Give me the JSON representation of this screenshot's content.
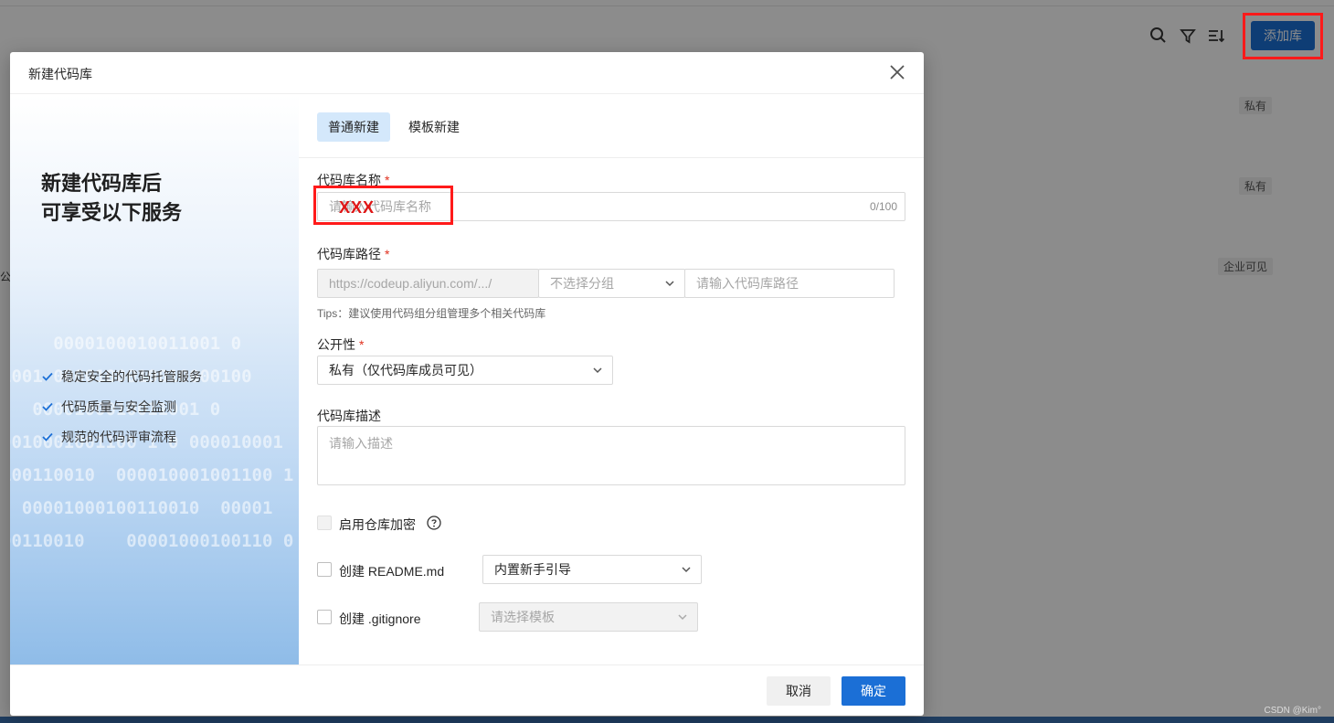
{
  "background": {
    "add_button_label": "添加库",
    "toolbar_icons": [
      "search-icon",
      "filter-icon",
      "sort-icon"
    ],
    "tags": [
      "私有",
      "私有",
      "企业可见"
    ],
    "partial_text": "公",
    "watermark": "CSDN @Kim°"
  },
  "dialog": {
    "title": "新建代码库",
    "side": {
      "headline": "新建代码库后\n可享受以下服务",
      "features": [
        "稳定安全的代码托管服务",
        "代码质量与安全监测",
        "规范的代码评审流程"
      ],
      "bits": "     0000100010011001 0\n1001 0000100010010000100\n   0000100010011001 0\n0010001001100 1 0 000010001\n100110010  000010001001100 1\n  00001000100110010  00001\n00110010    00001000100110 0"
    },
    "tabs": [
      {
        "label": "普通新建",
        "active": true
      },
      {
        "label": "模板新建",
        "active": false
      }
    ],
    "form": {
      "name_label": "代码库名称",
      "name_placeholder": "请输入代码库名称",
      "name_counter": "0/100",
      "name_annotation": "XXX",
      "path_label": "代码库路径",
      "path_prefix": "https://codeup.aliyun.com/.../",
      "path_group_placeholder": "不选择分组",
      "path_input_placeholder": "请输入代码库路径",
      "path_tips": "Tips：建议使用代码组分组管理多个相关代码库",
      "visibility_label": "公开性",
      "visibility_value": "私有（仅代码库成员可见）",
      "desc_label": "代码库描述",
      "desc_placeholder": "请输入描述",
      "encrypt_label": "启用仓库加密",
      "readme_label": "创建 README.md",
      "readme_select": "内置新手引导",
      "gitignore_label": "创建 .gitignore",
      "gitignore_select": "请选择模板"
    },
    "footer": {
      "cancel_label": "取消",
      "ok_label": "确定"
    }
  },
  "colors": {
    "primary": "#1b6fd6",
    "required": "#e0301e",
    "annotation": "#ff1a1a"
  }
}
